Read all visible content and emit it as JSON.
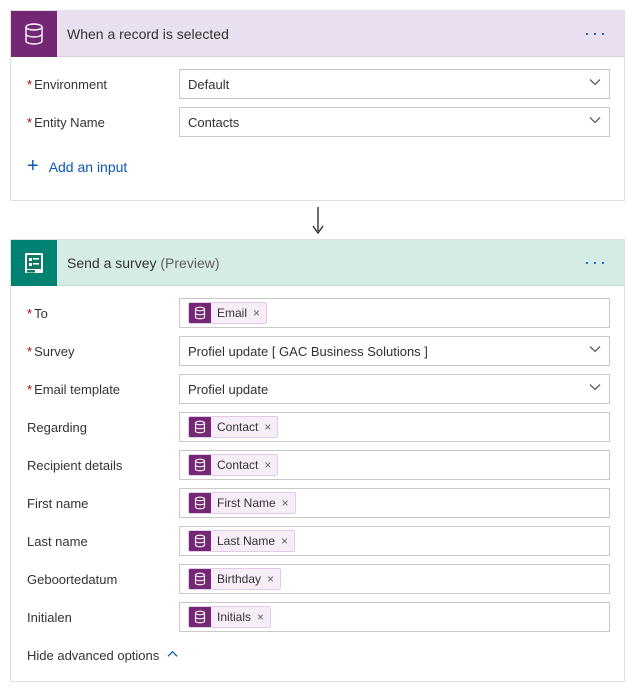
{
  "trigger": {
    "title": "When a record is selected",
    "fields": {
      "environment": {
        "label": "Environment",
        "value": "Default"
      },
      "entity": {
        "label": "Entity Name",
        "value": "Contacts"
      }
    },
    "addInput": "Add an input"
  },
  "action": {
    "title": "Send a survey",
    "previewTag": "(Preview)",
    "fields": {
      "to": {
        "label": "To"
      },
      "survey": {
        "label": "Survey",
        "value": "Profiel update [ GAC Business Solutions ]"
      },
      "template": {
        "label": "Email template",
        "value": "Profiel update"
      },
      "regarding": {
        "label": "Regarding"
      },
      "recipient": {
        "label": "Recipient details"
      },
      "firstname": {
        "label": "First name"
      },
      "lastname": {
        "label": "Last name"
      },
      "birthday": {
        "label": "Geboortedatum"
      },
      "initials": {
        "label": "Initialen"
      }
    },
    "tokens": {
      "email": "Email",
      "contact": "Contact",
      "firstname": "First Name",
      "lastname": "Last Name",
      "birthday": "Birthday",
      "initials": "Initials"
    },
    "advToggle": "Hide advanced options"
  }
}
